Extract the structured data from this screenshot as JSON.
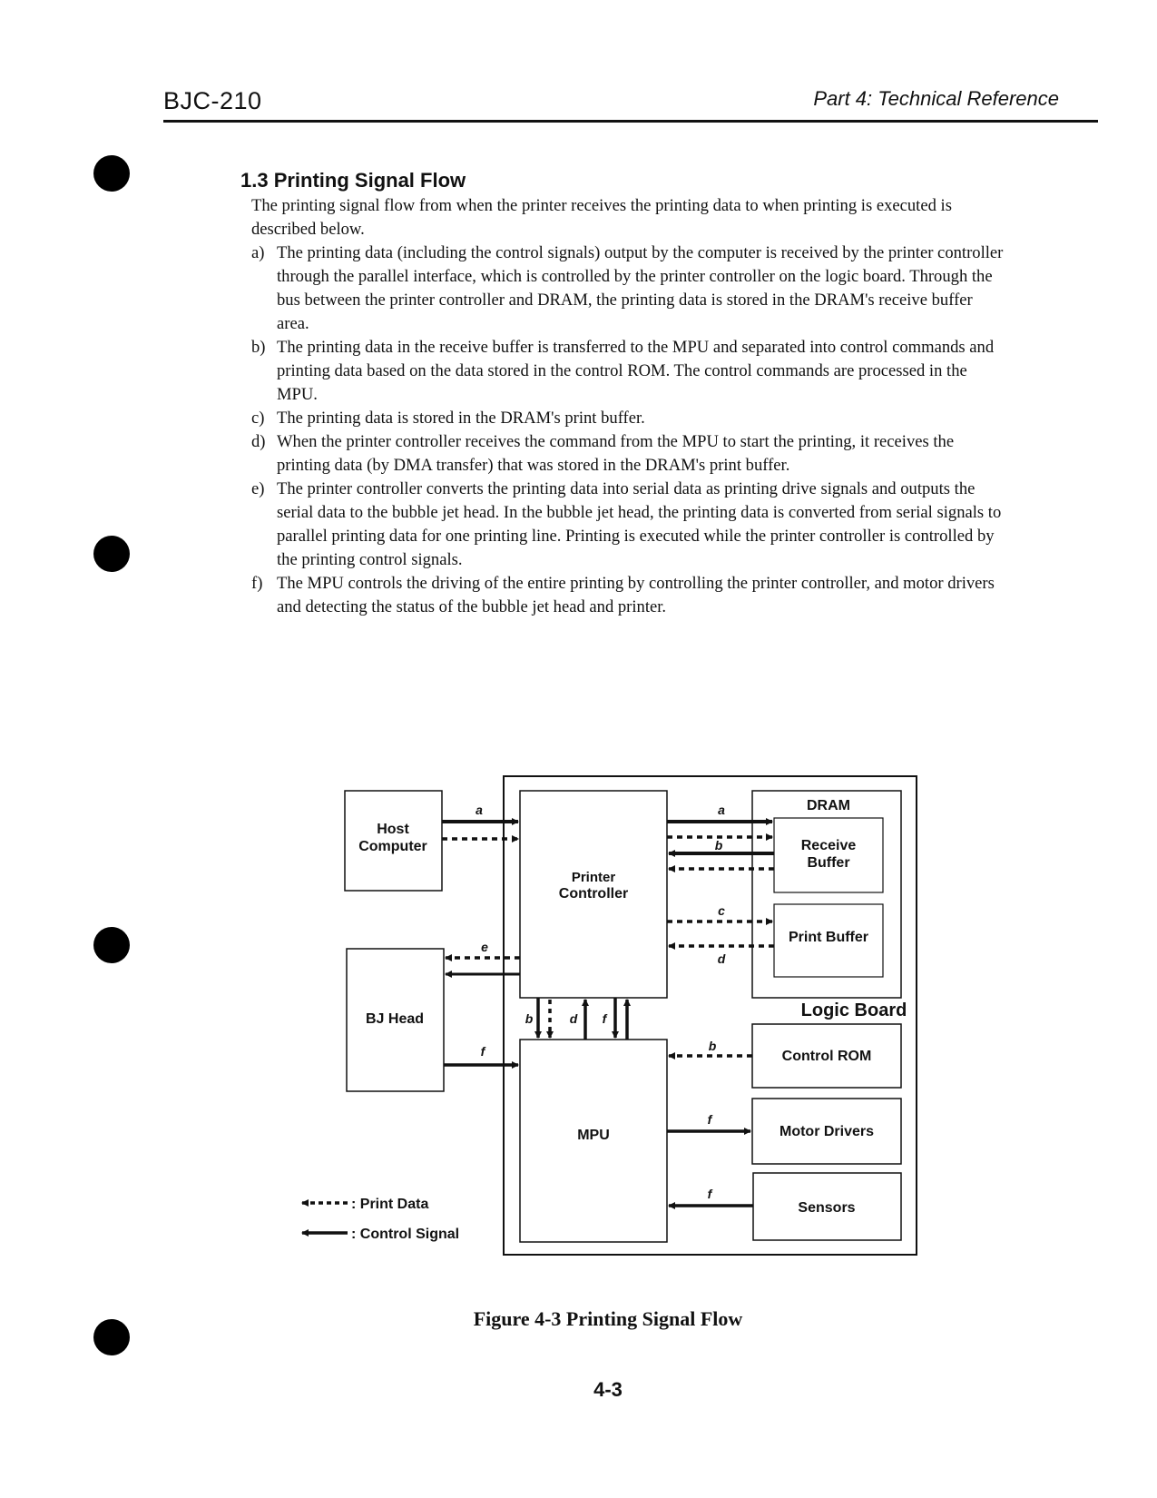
{
  "header": {
    "left": "BJC-210",
    "right": "Part 4: Technical Reference"
  },
  "section": {
    "title": "1.3 Printing Signal Flow",
    "intro": "The printing signal flow from when the printer receives the printing data to when printing is executed is described below.",
    "items": [
      {
        "label": "a)",
        "text": "The printing data (including the control signals) output by the computer is received by the printer controller through the parallel interface, which is controlled by the printer controller on the logic board.  Through the bus between the printer controller and DRAM, the printing data is stored in the DRAM's receive buffer area."
      },
      {
        "label": "b)",
        "text": "The printing data in the receive buffer is transferred to the MPU and separated into control commands and printing data based on the data stored in the control ROM. The control commands are processed in the MPU."
      },
      {
        "label": "c)",
        "text": "The printing data is stored in the DRAM's print buffer."
      },
      {
        "label": "d)",
        "text": "When the printer controller receives the command from the MPU to start the printing, it receives the printing data (by DMA transfer) that was stored in the DRAM's print buffer."
      },
      {
        "label": "e)",
        "text": "The printer controller converts the printing data into serial data as printing drive signals and outputs the serial data to the bubble jet head.  In the bubble jet head, the printing data is converted from serial signals to parallel printing data for one printing line.  Printing is executed while the printer controller is controlled by the printing control signals."
      },
      {
        "label": "f)",
        "text": "The MPU controls the driving of the entire printing by controlling the printer controller, and motor drivers and detecting the status of the bubble jet head and printer."
      }
    ]
  },
  "diagram": {
    "blocks": {
      "host": [
        "Host",
        "Computer"
      ],
      "printer_controller": [
        "Printer",
        "Controller"
      ],
      "dram": "DRAM",
      "receive_buffer": [
        "Receive",
        "Buffer"
      ],
      "print_buffer": "Print Buffer",
      "bj_head": "BJ Head",
      "logic_board": "Logic Board",
      "control_rom": "Control ROM",
      "mpu": "MPU",
      "motor_drivers": "Motor Drivers",
      "sensors": "Sensors"
    },
    "signal_labels": {
      "host_to_pc": "a",
      "pc_to_rb": "a",
      "rb_to_pc": "b",
      "pc_to_pb": "c",
      "pb_to_pc": "d",
      "pc_to_bj": "e",
      "bj_to_mpu": "f",
      "vert_b": "b",
      "vert_d": "d",
      "vert_f": "f",
      "rom_to_mpu": "b",
      "mpu_to_motor": "f",
      "sensors_to_mpu": "f"
    },
    "legend": {
      "print_data": ": Print Data",
      "control_signal": ": Control Signal"
    }
  },
  "figure_caption": "Figure 4-3 Printing Signal Flow",
  "page_number": "4-3"
}
